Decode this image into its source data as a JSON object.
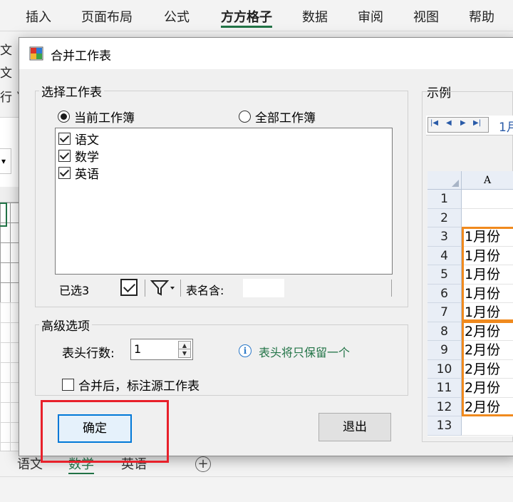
{
  "ribbon": {
    "tabs": [
      "插入",
      "页面布局",
      "公式",
      "方方格子",
      "数据",
      "审阅",
      "视图",
      "帮助"
    ],
    "active_tab": "方方格子",
    "left_fragments": [
      "文",
      "文",
      "行 ˅"
    ]
  },
  "sheet_tabs": [
    "语文",
    "数学",
    "英语"
  ],
  "active_sheet": "数学",
  "add_sheet_symbol": "+",
  "dialog": {
    "title": "合并工作表",
    "select_group": {
      "legend": "选择工作表",
      "radio_current": "当前工作簿",
      "radio_all": "全部工作簿",
      "selected_radio": "当前工作簿",
      "sheets": [
        {
          "label": "语文",
          "checked": true
        },
        {
          "label": "数学",
          "checked": true
        },
        {
          "label": "英语",
          "checked": true
        }
      ],
      "selected_count_label": "已选3",
      "name_contains_label": "表名含:",
      "name_contains_value": ""
    },
    "advanced_group": {
      "legend": "高级选项",
      "header_rows_label": "表头行数:",
      "header_rows_value": "1",
      "info_text": "表头将只保留一个",
      "mark_source_label": "合并后，标注源工作表",
      "mark_source_checked": false
    },
    "ok_button": "确定",
    "exit_button": "退出"
  },
  "example": {
    "legend": "示例",
    "tab_label": "1月",
    "column_header": "A",
    "row_numbers": [
      "1",
      "2",
      "3",
      "4",
      "5",
      "6",
      "7",
      "8",
      "9",
      "10",
      "11",
      "12",
      "13"
    ],
    "cells": [
      "",
      "",
      "1月份",
      "1月份",
      "1月份",
      "1月份",
      "1月份",
      "2月份",
      "2月份",
      "2月份",
      "2月份",
      "2月份",
      ""
    ]
  },
  "colors": {
    "accent_green": "#217346",
    "highlight_red": "#e8202a",
    "example_orange": "#f08a1e",
    "focus_blue": "#0078d7"
  }
}
